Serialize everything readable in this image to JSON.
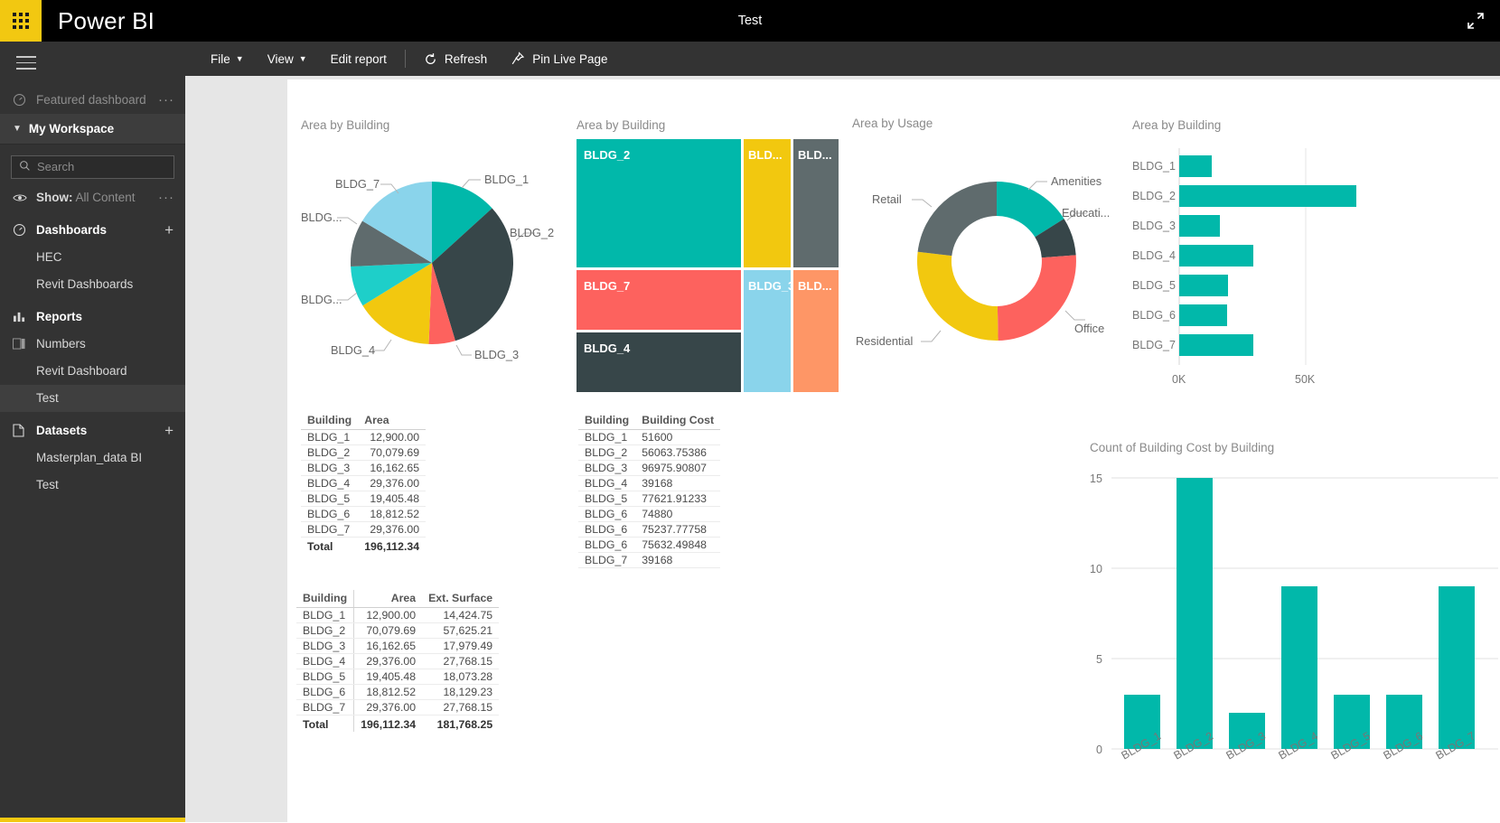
{
  "topbar": {
    "brand": "Power BI",
    "title": "Test",
    "waffle_icon": "app-launcher-icon",
    "expand_icon": "full-screen-icon",
    "brand_bg": "#f2c811"
  },
  "sidebar": {
    "hamburger_icon": "hamburger-menu-icon",
    "featured": {
      "label": "Featured dashboard",
      "icon": "dashboard-icon",
      "more": "···"
    },
    "workspace": {
      "label": "My Workspace",
      "chevron": "chevron-down-icon"
    },
    "search": {
      "placeholder": "Search",
      "value": "",
      "icon": "search-icon"
    },
    "show": {
      "label": "Show:",
      "value": "All Content",
      "icon": "eye-icon",
      "more": "···"
    },
    "groups": [
      {
        "label": "Dashboards",
        "icon": "dashboard-icon",
        "add": "+",
        "items": [
          {
            "label": "HEC",
            "selected": false
          },
          {
            "label": "Revit Dashboards",
            "selected": false
          }
        ]
      },
      {
        "label": "Reports",
        "icon": "bar-chart-icon",
        "add": "",
        "items": [
          {
            "label": "Numbers",
            "selected": false,
            "icon": "report-icon"
          },
          {
            "label": "Revit Dashboard",
            "selected": false
          },
          {
            "label": "Test",
            "selected": true
          }
        ]
      },
      {
        "label": "Datasets",
        "icon": "dataset-icon",
        "add": "+",
        "items": [
          {
            "label": "Masterplan_data BI",
            "selected": false
          },
          {
            "label": "Test",
            "selected": false
          }
        ]
      }
    ]
  },
  "report_toolbar": {
    "items": [
      {
        "label": "File",
        "caret": true,
        "icon": ""
      },
      {
        "label": "View",
        "caret": true,
        "icon": ""
      },
      {
        "label": "Edit report",
        "caret": false,
        "icon": ""
      },
      {
        "label": "Refresh",
        "caret": false,
        "icon": "refresh-icon"
      },
      {
        "label": "Pin Live Page",
        "caret": false,
        "icon": "pin-icon"
      }
    ]
  },
  "palette": {
    "teal": "#01B8AA",
    "dark": "#374649",
    "red": "#FD625E",
    "yellow": "#F2C80F",
    "teal2": "#1ECFC9",
    "gray": "#5F6B6D",
    "skyblue": "#8AD4EB",
    "orange": "#FE9666"
  },
  "chart_data": [
    {
      "id": "pie-area-by-building",
      "type": "pie",
      "title": "Area by Building",
      "categories": [
        "BLDG_1",
        "BLDG_2",
        "BLDG_3",
        "BLDG_4",
        "BLDG_5",
        "BLDG_6",
        "BLDG_7"
      ],
      "values": [
        12900.0,
        70079.69,
        16162.65,
        29376.0,
        19405.48,
        18812.52,
        29376.0
      ],
      "colors": [
        "#01B8AA",
        "#374649",
        "#FD625E",
        "#F2C80F",
        "#1ECFC9",
        "#5F6B6D",
        "#8AD4EB"
      ],
      "labels_shown": [
        "BLDG_1",
        "BLDG_2",
        "BLDG_3",
        "BLDG_4",
        "BLDG...",
        "BLDG...",
        "BLDG_7"
      ],
      "legend": "none",
      "grid": false
    },
    {
      "id": "treemap-area-by-building",
      "type": "treemap",
      "title": "Area by Building",
      "categories": [
        "BLDG_2",
        "BLDG_7",
        "BLDG_4",
        "BLDG_5",
        "BLDG_3",
        "BLDG_6",
        "BLDG_1"
      ],
      "values": [
        70079.69,
        29376.0,
        29376.0,
        19405.48,
        16162.65,
        18812.52,
        12900.0
      ],
      "labels_shown": [
        "BLDG_2",
        "BLDG_7",
        "BLDG_4",
        "BLD...",
        "BLDG_3",
        "BLD...",
        "BLD..."
      ],
      "colors": [
        "#01B8AA",
        "#FD625E",
        "#374649",
        "#F2C80F",
        "#8AD4EB",
        "#5F6B6D",
        "#FE9666"
      ]
    },
    {
      "id": "donut-area-by-usage",
      "type": "pie",
      "title": "Area by Usage",
      "categories": [
        "Amenities",
        "Education",
        "Office",
        "Residential",
        "Retail"
      ],
      "values": [
        15,
        11,
        27,
        22,
        25
      ],
      "colors": [
        "#01B8AA",
        "#374649",
        "#FD625E",
        "#F2C80F",
        "#5F6B6D"
      ],
      "labels_shown": [
        "Amenities",
        "Educati...",
        "Office",
        "Residential",
        "Retail"
      ],
      "donut": true
    },
    {
      "id": "hbar-area-by-building",
      "type": "bar",
      "orientation": "horizontal",
      "title": "Area by Building",
      "categories": [
        "BLDG_1",
        "BLDG_2",
        "BLDG_3",
        "BLDG_4",
        "BLDG_5",
        "BLDG_6",
        "BLDG_7"
      ],
      "values": [
        12900.0,
        70079.69,
        16162.65,
        29376.0,
        19405.48,
        18812.52,
        29376.0
      ],
      "color": "#01B8AA",
      "xticks": [
        "0K",
        "50K"
      ],
      "xtick_values": [
        0,
        50000
      ],
      "xlim": [
        0,
        72000
      ],
      "grid": true
    },
    {
      "id": "vbar-count-building-cost",
      "type": "bar",
      "orientation": "vertical",
      "title": "Count of Building Cost  by Building",
      "categories": [
        "BLDG_1",
        "BLDG_2",
        "BLDG_3",
        "BLDG_4",
        "BLDG_5",
        "BLDG_6",
        "BLDG_7"
      ],
      "values": [
        3,
        15,
        2,
        9,
        3,
        3,
        9
      ],
      "color": "#01B8AA",
      "yticks": [
        "0",
        "5",
        "10",
        "15"
      ],
      "ytick_values": [
        0,
        5,
        10,
        15
      ],
      "ylim": [
        0,
        15
      ],
      "grid": true
    }
  ],
  "tables": {
    "area": {
      "headers": [
        "Building",
        "Area"
      ],
      "rows": [
        [
          "BLDG_1",
          "12,900.00"
        ],
        [
          "BLDG_2",
          "70,079.69"
        ],
        [
          "BLDG_3",
          "16,162.65"
        ],
        [
          "BLDG_4",
          "29,376.00"
        ],
        [
          "BLDG_5",
          "19,405.48"
        ],
        [
          "BLDG_6",
          "18,812.52"
        ],
        [
          "BLDG_7",
          "29,376.00"
        ]
      ],
      "total": [
        "Total",
        "196,112.34"
      ]
    },
    "cost": {
      "headers": [
        "Building",
        "Building Cost"
      ],
      "rows": [
        [
          "BLDG_1",
          "51600"
        ],
        [
          "BLDG_2",
          "56063.75386"
        ],
        [
          "BLDG_3",
          "96975.90807"
        ],
        [
          "BLDG_4",
          "39168"
        ],
        [
          "BLDG_5",
          "77621.91233"
        ],
        [
          "BLDG_6",
          "74880"
        ],
        [
          "BLDG_6",
          "75237.77758"
        ],
        [
          "BLDG_6",
          "75632.49848"
        ],
        [
          "BLDG_7",
          "39168"
        ]
      ]
    },
    "surface": {
      "headers": [
        "Building",
        "Area",
        "Ext. Surface"
      ],
      "rows": [
        [
          "BLDG_1",
          "12,900.00",
          "14,424.75"
        ],
        [
          "BLDG_2",
          "70,079.69",
          "57,625.21"
        ],
        [
          "BLDG_3",
          "16,162.65",
          "17,979.49"
        ],
        [
          "BLDG_4",
          "29,376.00",
          "27,768.15"
        ],
        [
          "BLDG_5",
          "19,405.48",
          "18,073.28"
        ],
        [
          "BLDG_6",
          "18,812.52",
          "18,129.23"
        ],
        [
          "BLDG_7",
          "29,376.00",
          "27,768.15"
        ]
      ],
      "total": [
        "Total",
        "196,112.34",
        "181,768.25"
      ]
    }
  }
}
